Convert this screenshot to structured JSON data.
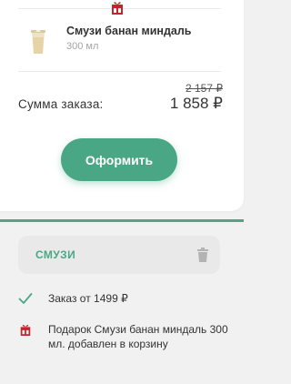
{
  "cart": {
    "item": {
      "name": "Смузи банан миндаль",
      "volume": "300 мл"
    },
    "total_label": "Сумма заказа:",
    "old_price": "2 157 ₽",
    "new_price": "1 858 ₽",
    "checkout_label": "Оформить"
  },
  "promo": {
    "code": "СМУЗИ",
    "conditions": [
      {
        "icon": "check-icon",
        "text": "Заказ от 1499 ₽"
      },
      {
        "icon": "gift-icon",
        "text": "Подарок Смузи банан миндаль 300 мл. добавлен в корзину"
      }
    ]
  },
  "colors": {
    "accent_green": "#4aa785",
    "gift_red": "#c0262c"
  }
}
